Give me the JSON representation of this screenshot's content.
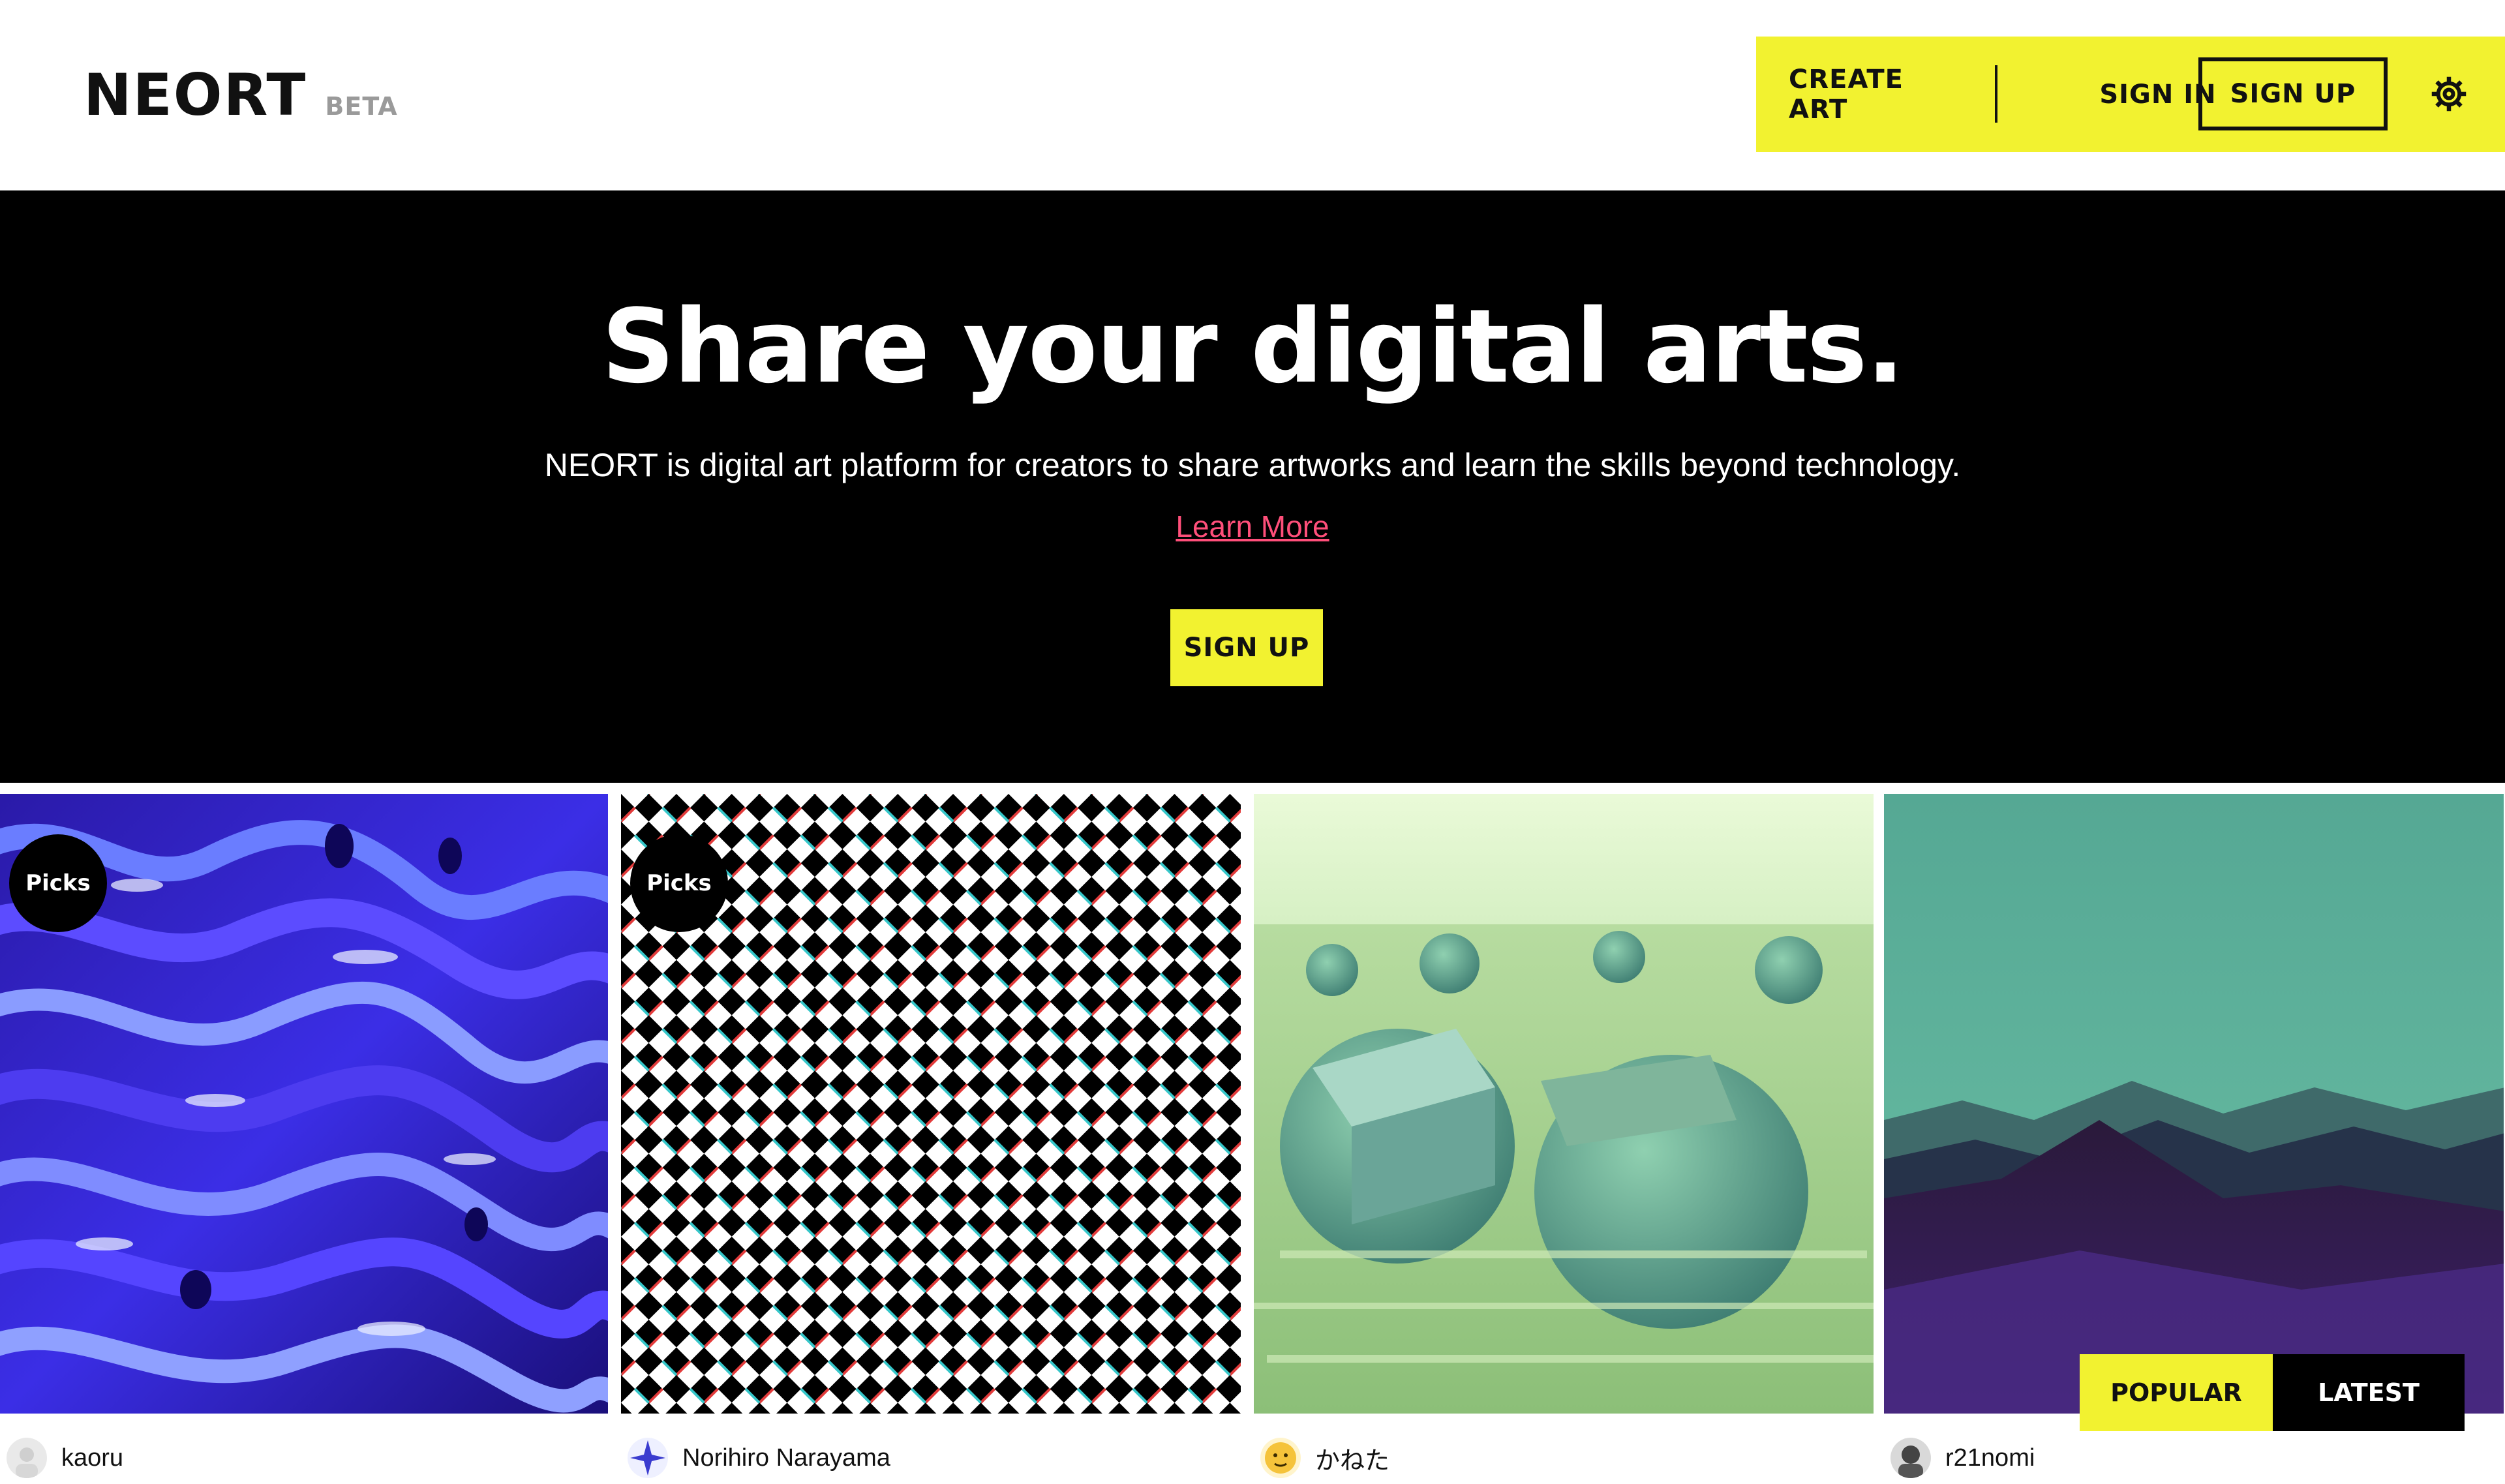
{
  "header": {
    "logo": "NEORT",
    "beta": "BETA",
    "nav": {
      "create_art": "CREATE ART",
      "sign_in": "SIGN IN",
      "sign_up": "SIGN UP",
      "settings_icon": "gear-icon"
    },
    "accent_color": "#f2f230"
  },
  "hero": {
    "title": "Share your digital arts.",
    "description": "NEORT is digital art platform for creators to share artworks and learn the skills beyond technology.",
    "learn_more": "Learn More",
    "cta": "SIGN UP",
    "link_color": "#ff4f7a"
  },
  "gallery": {
    "items": [
      {
        "badge": "Picks",
        "author": "kaoru"
      },
      {
        "badge": "Picks",
        "author": "Norihiro Narayama"
      },
      {
        "badge": "",
        "author": "かねた"
      },
      {
        "badge": "",
        "author": "r21nomi"
      }
    ],
    "sort": {
      "popular": "POPULAR",
      "latest": "LATEST"
    }
  }
}
